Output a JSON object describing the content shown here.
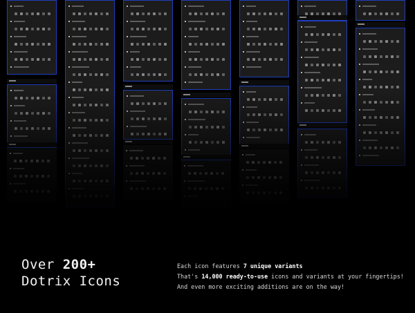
{
  "headline": {
    "line1_prefix": "Over",
    "line1_highlight": "200+",
    "line2": "Dotrix Icons"
  },
  "features": {
    "line1_prefix": "Each icon features",
    "line1_highlight": "7 unique variants",
    "line2_prefix": "That's",
    "line2_highlight": "14,000 ready-to-use",
    "line2_suffix": "icons and variants at your fingertips!",
    "line3": "And even more exciting additions are on the way!"
  },
  "colors": {
    "background": "#000000",
    "panel": "#1c1c1c",
    "panel_outline": "#1f3fbf",
    "text": "#f2f2f2"
  }
}
